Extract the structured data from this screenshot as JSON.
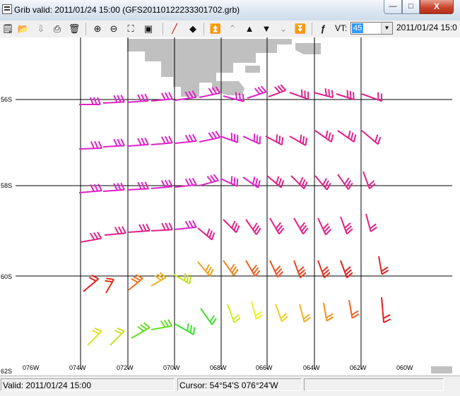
{
  "window": {
    "title": "Grib valid: 2011/01/24 15:00 (GFS20110122233301702.grb)",
    "controls": {
      "minimize": "—",
      "maximize": "□",
      "close": "X"
    }
  },
  "toolbar": {
    "icons": [
      "properties-icon",
      "open-folder-icon",
      "import-icon",
      "print-icon",
      "delete-icon",
      "zoom-in-icon",
      "zoom-out-icon",
      "zoom-extent-icon",
      "zoom-window-icon",
      "draw-line-icon",
      "draw-point-icon",
      "first-icon",
      "previous-page-icon",
      "previous-icon",
      "next-icon",
      "next-page-icon",
      "last-icon",
      "function-icon"
    ],
    "vt_label": "VT:",
    "vt_value": "45",
    "date": "2011/01/24 15:0"
  },
  "map": {
    "lat_labels": [
      "56S",
      "58S",
      "60S",
      "62S"
    ],
    "lon_labels": [
      "076W",
      "074W",
      "072W",
      "070W",
      "068W",
      "066W",
      "064W",
      "062W",
      "060W"
    ],
    "land_color": "#c0c0c0",
    "grid_color": "#000000"
  },
  "status": {
    "valid": "Valid: 2011/01/24 15:00",
    "cursor": "Cursor: 54°54'S  076°24'W"
  }
}
